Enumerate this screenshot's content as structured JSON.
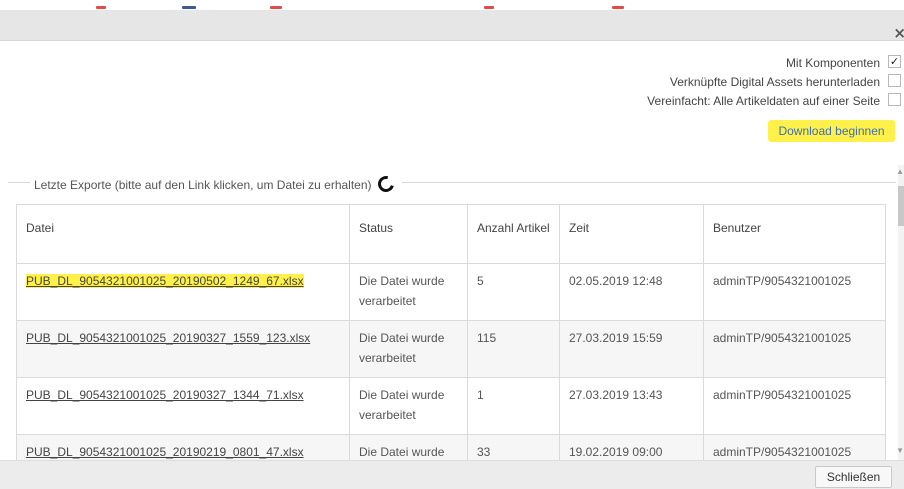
{
  "dialog": {
    "close_icon": "close-icon",
    "close_glyph": "×"
  },
  "options": {
    "items": [
      {
        "label": "Mit Komponenten",
        "checked": true,
        "mark": "✓"
      },
      {
        "label": "Verknüpfte Digital Assets herunterladen",
        "checked": false,
        "mark": ""
      },
      {
        "label": "Vereinfacht: Alle Artikeldaten auf einer Seite",
        "checked": false,
        "mark": ""
      }
    ],
    "download_button": "Download beginnen"
  },
  "exports": {
    "legend": "Letzte Exporte (bitte auf den Link klicken, um Datei zu erhalten)",
    "refresh_icon": "refresh-spinner-icon",
    "columns": [
      "Datei",
      "Status",
      "Anzahl Artikel",
      "Zeit",
      "Benutzer"
    ],
    "rows": [
      {
        "file": "PUB_DL_9054321001025_20190502_1249_67.xlsx",
        "status": "Die Datei wurde verarbeitet",
        "count": "5",
        "time": "02.05.2019 12:48",
        "user": "adminTP/9054321001025"
      },
      {
        "file": "PUB_DL_9054321001025_20190327_1559_123.xlsx",
        "status": "Die Datei wurde verarbeitet",
        "count": "115",
        "time": "27.03.2019 15:59",
        "user": "adminTP/9054321001025"
      },
      {
        "file": "PUB_DL_9054321001025_20190327_1344_71.xlsx",
        "status": "Die Datei wurde verarbeitet",
        "count": "1",
        "time": "27.03.2019 13:43",
        "user": "adminTP/9054321001025"
      },
      {
        "file": "PUB_DL_9054321001025_20190219_0801_47.xlsx",
        "status": "Die Datei wurde verarbeitet",
        "count": "33",
        "time": "19.02.2019 09:00",
        "user": "adminTP/9054321001025"
      }
    ]
  },
  "footer": {
    "close_button": "Schließen"
  },
  "colors": {
    "highlight": "#fff14a",
    "link_blue": "#3a6fb5",
    "titlebar": "#e6e6e6"
  }
}
